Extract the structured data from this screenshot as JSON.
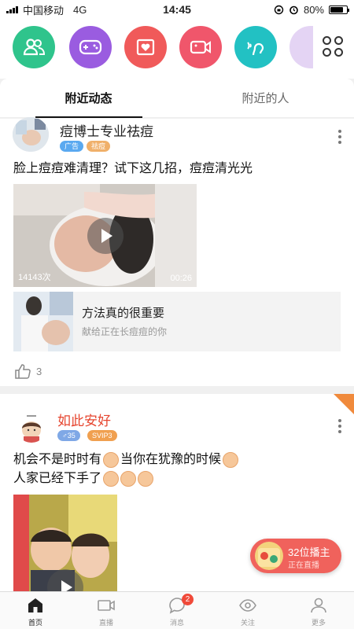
{
  "status_bar": {
    "carrier": "中国移动",
    "network": "4G",
    "time": "14:45",
    "battery": "80%",
    "battery_level": 0.8
  },
  "top_icons": [
    {
      "name": "friends-icon",
      "color": "#2fc48c"
    },
    {
      "name": "game-controller-icon",
      "color": "#9a5ce0"
    },
    {
      "name": "photo-heart-icon",
      "color": "#f05a5a"
    },
    {
      "name": "video-camera-icon",
      "color": "#f0566b"
    },
    {
      "name": "voice-icon",
      "color": "#22c1c3"
    },
    {
      "name": "partial-category-icon",
      "color": "#e4d4f4"
    }
  ],
  "tabs": [
    {
      "label": "附近动态",
      "active": true
    },
    {
      "label": "附近的人",
      "active": false
    }
  ],
  "post1": {
    "username": "痘博士专业祛痘",
    "tags": [
      {
        "label": "广告",
        "color": "#5aa9f0"
      },
      {
        "label": "祛痘",
        "color": "#f0b06a"
      }
    ],
    "text": "脸上痘痘难清理？试下这几招，痘痘清光光",
    "video": {
      "views": "14143次",
      "duration": "00:26"
    },
    "link_card": {
      "title": "方法真的很重要",
      "subtitle": "献给正在长痘痘的你"
    },
    "likes": "3"
  },
  "post2": {
    "username": "如此安好",
    "tags": [
      {
        "label": "♂35",
        "color": "#7fa8e6"
      },
      {
        "label": "SVIP3",
        "color": "#f0a050"
      }
    ],
    "text_line1": "机会不是时时有",
    "text_line1b": "当你在犹豫的时候",
    "text_line2": "人家已经下手了",
    "accent": "#e6452f"
  },
  "live_float": {
    "title": "32位播主",
    "subtitle": "正在直播"
  },
  "bottom_nav": [
    {
      "label": "首页",
      "icon": "home-icon",
      "active": true
    },
    {
      "label": "直播",
      "icon": "live-camera-icon",
      "active": false
    },
    {
      "label": "消息",
      "icon": "message-bubble-icon",
      "active": false,
      "badge": "2"
    },
    {
      "label": "关注",
      "icon": "eye-icon",
      "active": false
    },
    {
      "label": "更多",
      "icon": "person-icon",
      "active": false
    }
  ]
}
